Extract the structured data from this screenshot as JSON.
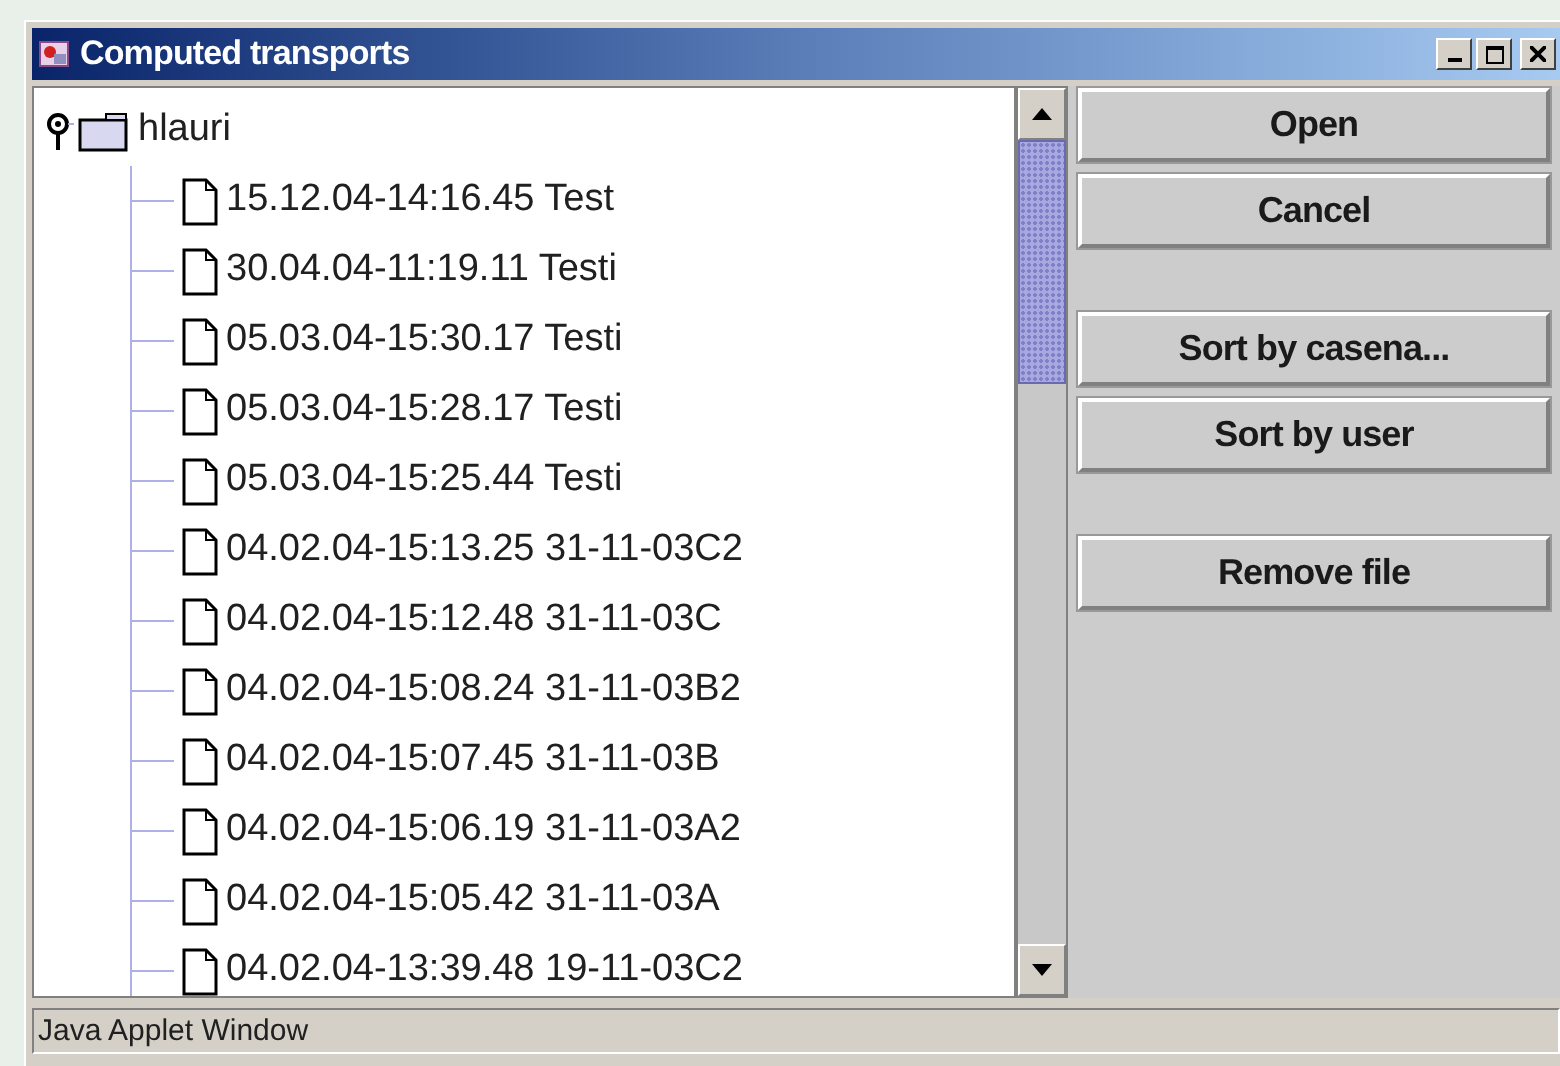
{
  "window": {
    "title": "Computed transports"
  },
  "tree": [
    {
      "label": "hlauri",
      "expanded": true,
      "children": [
        {
          "label": "15.12.04-14:16.45 Test"
        },
        {
          "label": "30.04.04-11:19.11 Testi"
        },
        {
          "label": "05.03.04-15:30.17 Testi"
        },
        {
          "label": "05.03.04-15:28.17 Testi"
        },
        {
          "label": "05.03.04-15:25.44 Testi"
        },
        {
          "label": "04.02.04-15:13.25 31-11-03C2"
        },
        {
          "label": "04.02.04-15:12.48 31-11-03C"
        },
        {
          "label": "04.02.04-15:08.24 31-11-03B2"
        },
        {
          "label": "04.02.04-15:07.45 31-11-03B"
        },
        {
          "label": "04.02.04-15:06.19 31-11-03A2"
        },
        {
          "label": "04.02.04-15:05.42 31-11-03A"
        },
        {
          "label": "04.02.04-13:39.48 19-11-03C2"
        }
      ]
    }
  ],
  "buttons": [
    {
      "label": "Open",
      "kind": "button"
    },
    {
      "label": "Cancel",
      "kind": "button"
    },
    {
      "kind": "gap"
    },
    {
      "label": "Sort by casena...",
      "kind": "button"
    },
    {
      "label": "Sort by user",
      "kind": "button"
    },
    {
      "kind": "gap"
    },
    {
      "label": "Remove file",
      "kind": "button"
    }
  ],
  "status_bar": "Java Applet Window"
}
